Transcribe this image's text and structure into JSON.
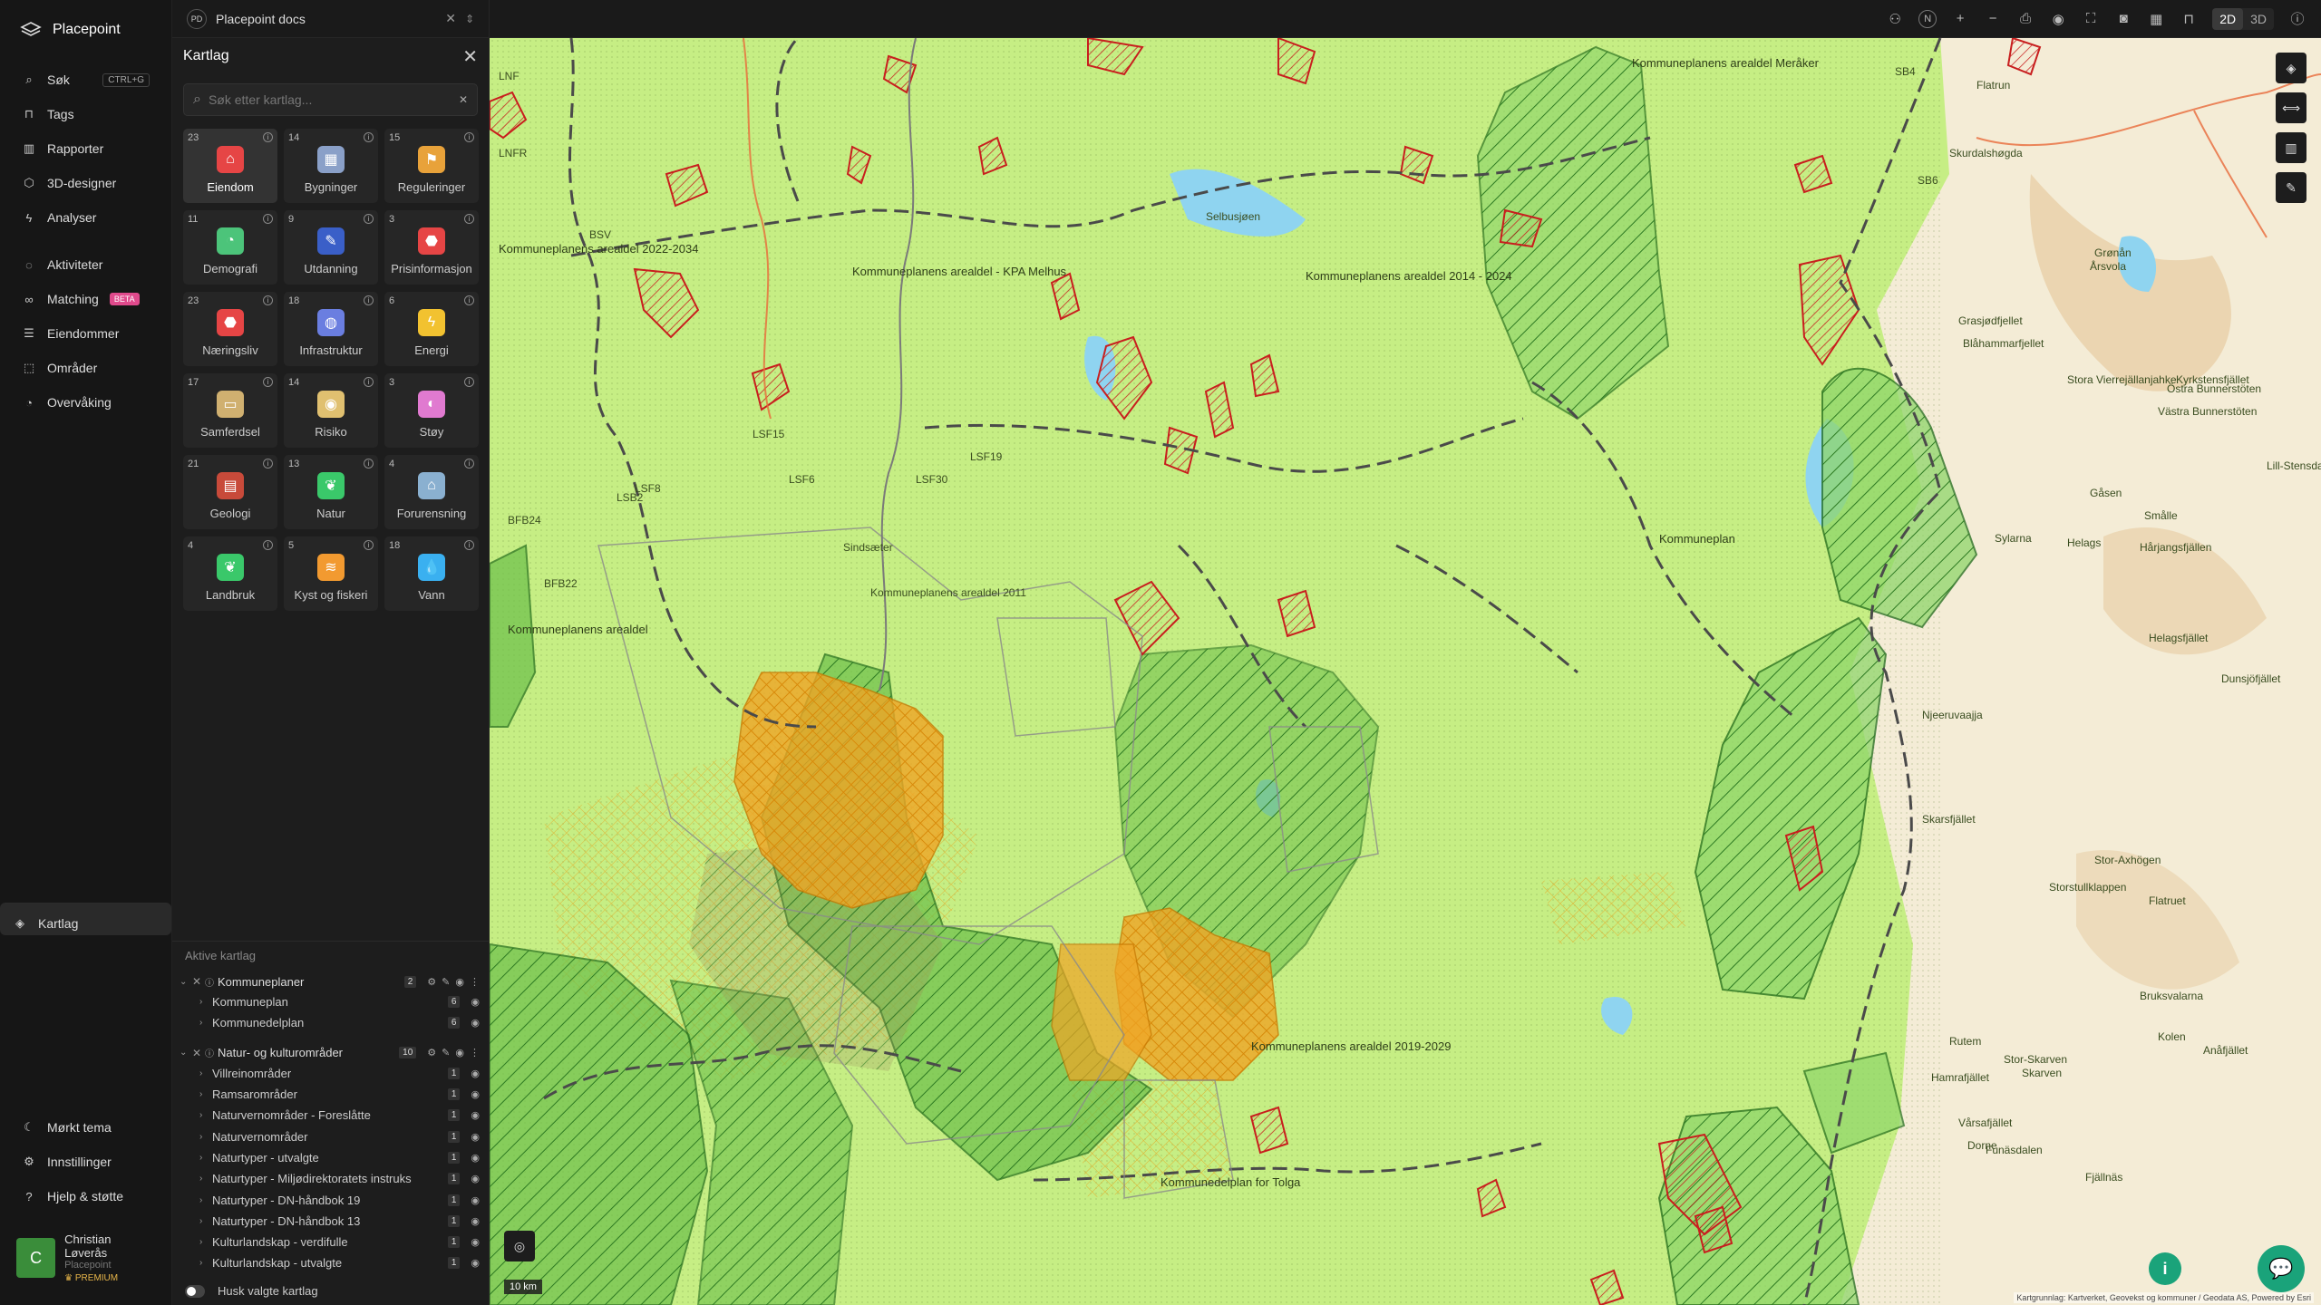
{
  "app": {
    "name": "Placepoint"
  },
  "nav": {
    "items": [
      {
        "label": "Søk",
        "shortcut": "CTRL+G"
      },
      {
        "label": "Kartlag"
      },
      {
        "label": "Tags"
      },
      {
        "label": "Rapporter"
      },
      {
        "label": "3D-designer"
      },
      {
        "label": "Analyser"
      }
    ],
    "items2": [
      {
        "label": "Aktiviteter"
      },
      {
        "label": "Matching",
        "badge": "BETA"
      },
      {
        "label": "Eiendommer"
      },
      {
        "label": "Områder"
      },
      {
        "label": "Overvåking"
      }
    ],
    "bottom": [
      {
        "label": "Mørkt tema"
      },
      {
        "label": "Innstillinger"
      },
      {
        "label": "Hjelp & støtte"
      }
    ],
    "user": {
      "initial": "C",
      "name": "Christian Løverås",
      "org": "Placepoint",
      "plan": "PREMIUM"
    }
  },
  "workspace": {
    "badge": "PD",
    "name": "Placepoint docs"
  },
  "topbar": {
    "mode2d": "2D",
    "mode3d": "3D"
  },
  "panel": {
    "title": "Kartlag",
    "search_placeholder": "Søk etter kartlag...",
    "categories": [
      {
        "count": "23",
        "label": "Eiendom",
        "color": "#e64545"
      },
      {
        "count": "14",
        "label": "Bygninger",
        "color": "#8aa0c8"
      },
      {
        "count": "15",
        "label": "Reguleringer",
        "color": "#e8a23a"
      },
      {
        "count": "11",
        "label": "Demografi",
        "color": "#4cc47a"
      },
      {
        "count": "9",
        "label": "Utdanning",
        "color": "#3a5fc8"
      },
      {
        "count": "3",
        "label": "Prisinformasjon",
        "color": "#e64545"
      },
      {
        "count": "23",
        "label": "Næringsliv",
        "color": "#e64545"
      },
      {
        "count": "18",
        "label": "Infrastruktur",
        "color": "#6a7ee0"
      },
      {
        "count": "6",
        "label": "Energi",
        "color": "#f2c230"
      },
      {
        "count": "17",
        "label": "Samferdsel",
        "color": "#d0b070"
      },
      {
        "count": "14",
        "label": "Risiko",
        "color": "#e0c070"
      },
      {
        "count": "3",
        "label": "Støy",
        "color": "#e07ad0"
      },
      {
        "count": "21",
        "label": "Geologi",
        "color": "#c84a3a"
      },
      {
        "count": "13",
        "label": "Natur",
        "color": "#3ac86a"
      },
      {
        "count": "4",
        "label": "Forurensning",
        "color": "#8ab0d0"
      },
      {
        "count": "4",
        "label": "Landbruk",
        "color": "#3ac86a"
      },
      {
        "count": "5",
        "label": "Kyst og fiskeri",
        "color": "#f29a30"
      },
      {
        "count": "18",
        "label": "Vann",
        "color": "#3ab0f0"
      }
    ],
    "active_title": "Aktive kartlag",
    "groups": [
      {
        "name": "Kommuneplaner",
        "count": "2",
        "layers": [
          {
            "name": "Kommuneplan",
            "count": "6"
          },
          {
            "name": "Kommunedelplan",
            "count": "6"
          }
        ]
      },
      {
        "name": "Natur- og kulturområder",
        "count": "10",
        "layers": [
          {
            "name": "Villreinområder",
            "count": "1"
          },
          {
            "name": "Ramsarområder",
            "count": "1"
          },
          {
            "name": "Naturvernområder - Foreslåtte",
            "count": "1"
          },
          {
            "name": "Naturvernområder",
            "count": "1"
          },
          {
            "name": "Naturtyper - utvalgte",
            "count": "1"
          },
          {
            "name": "Naturtyper - Miljødirektoratets instruks",
            "count": "1"
          },
          {
            "name": "Naturtyper - DN-håndbok 19",
            "count": "1"
          },
          {
            "name": "Naturtyper - DN-håndbok 13",
            "count": "1"
          },
          {
            "name": "Kulturlandskap - verdifulle",
            "count": "1"
          },
          {
            "name": "Kulturlandskap - utvalgte",
            "count": "1"
          }
        ]
      }
    ],
    "remember_label": "Husk valgte kartlag"
  },
  "map": {
    "scale": "10 km",
    "attribution": "Kartgrunnlag: Kartverket, Geovekst og kommuner / Geodata AS, Powered by Esri",
    "labels": [
      "Kommuneplanens arealdel 2022-2034",
      "Kommuneplanens arealdel - KPA Melhus",
      "Kommuneplanens arealdel 2014 - 2024",
      "Kommuneplanens arealdel",
      "Kommuneplanens arealdel 2019-2029",
      "Kommuneplan",
      "Kommuneplanens arealdel Meråker",
      "Kommunedelplan for Tolga",
      "Selbusjøen",
      "Flatrun",
      "Skurdalshøgda",
      "Grønån",
      "Årsvola",
      "Grasjødfjellet",
      "Blåhammarfjellet",
      "Stora Vierrejällanjahke",
      "Östra Bunnerstöten",
      "Västra Bunnerstöten",
      "Kyrkstensfjället",
      "Lill-Stensdalsfjället",
      "Gåsen",
      "Smålle",
      "Sylarna",
      "Helags",
      "Hårjangsfjällen",
      "Helagsfjället",
      "Dunsjöfjället",
      "Njeeruvaajja",
      "Skarsfjället",
      "Stor-Axhögen",
      "Storstullklappen",
      "Flatruet",
      "Bruksvalarna",
      "Rutem",
      "Hamrafjället",
      "Stor-Skarven",
      "Skarven",
      "Anåfjället",
      "Vårsafjället",
      "Funäsdalen",
      "Fjällnäs",
      "Dorne",
      "Kolen",
      "LNF",
      "LNFR",
      "BSV",
      "LSF19",
      "LSF30",
      "LSF15",
      "LSF6",
      "LSF8",
      "LSB2",
      "BFB22",
      "BFB24",
      "SB4",
      "SB6",
      "Sindsæter",
      "Kommuneplanens arealdel 2011"
    ]
  }
}
